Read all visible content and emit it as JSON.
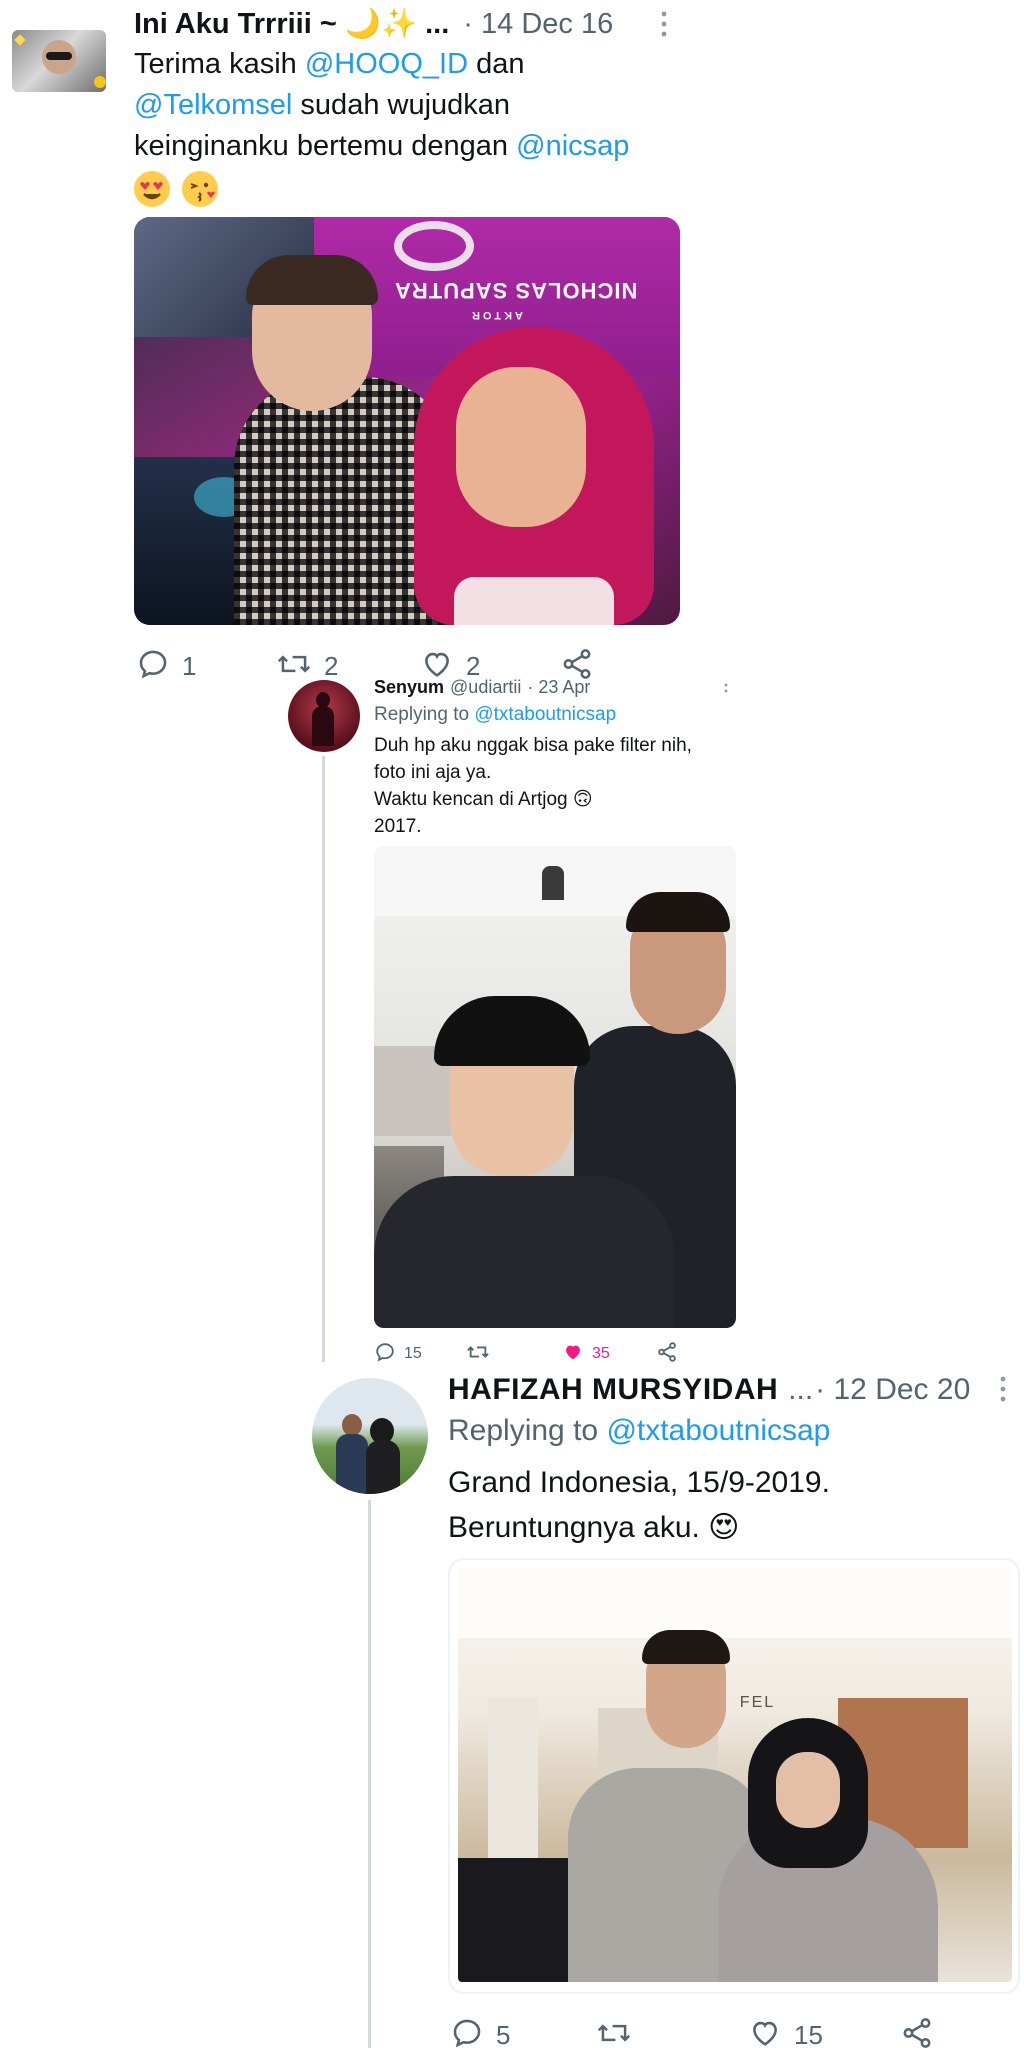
{
  "tweet1": {
    "display_name": "Ini Aku Trrriii ~ 🌙✨ ...",
    "date": "· 14 Dec 16",
    "text_line1_pre": "Terima kasih ",
    "mention1": "@HOOQ_ID",
    "text_line1_post": " dan",
    "mention2": "@Telkomsel",
    "text_line2_post": " sudah wujudkan",
    "text_line3_pre": "keinginanku bertemu dengan ",
    "mention3": "@nicsap",
    "emojis": "😍😘",
    "photo_sign_line1": "NICHOLAS SAPUTRA",
    "photo_sign_line2": "AKTOR",
    "replies": "1",
    "retweets": "2",
    "likes": "2"
  },
  "tweet2": {
    "display_name": "Senyum",
    "handle": "@udiartii",
    "date": "· 23 Apr",
    "replying_label": "Replying to ",
    "replying_handle": "@txtaboutnicsap",
    "text_line1": "Duh hp aku nggak bisa pake filter nih,",
    "text_line2": "foto ini aja ya.",
    "text_line3": "Waktu kencan di Artjog 🙃",
    "text_line4": "2017.",
    "replies": "15",
    "retweets": "",
    "likes": "35",
    "like_color": "#f91880"
  },
  "tweet3": {
    "display_name": "HAFIZAH MURSYIDAH",
    "ellipsis": "...",
    "date": "· 12 Dec 20",
    "replying_label": "Replying to ",
    "replying_handle": "@txtaboutnicsap",
    "text_line1": "Grand Indonesia, 15/9-2019.",
    "text_line2": "Beruntungnya aku. 😍",
    "photo_sign": "BA    FEL",
    "replies": "5",
    "retweets": "",
    "likes": "15"
  },
  "colors": {
    "link": "#1d9bf0",
    "muted": "#536471",
    "like_active": "#f91880",
    "thread_line": "#cfd9de"
  }
}
